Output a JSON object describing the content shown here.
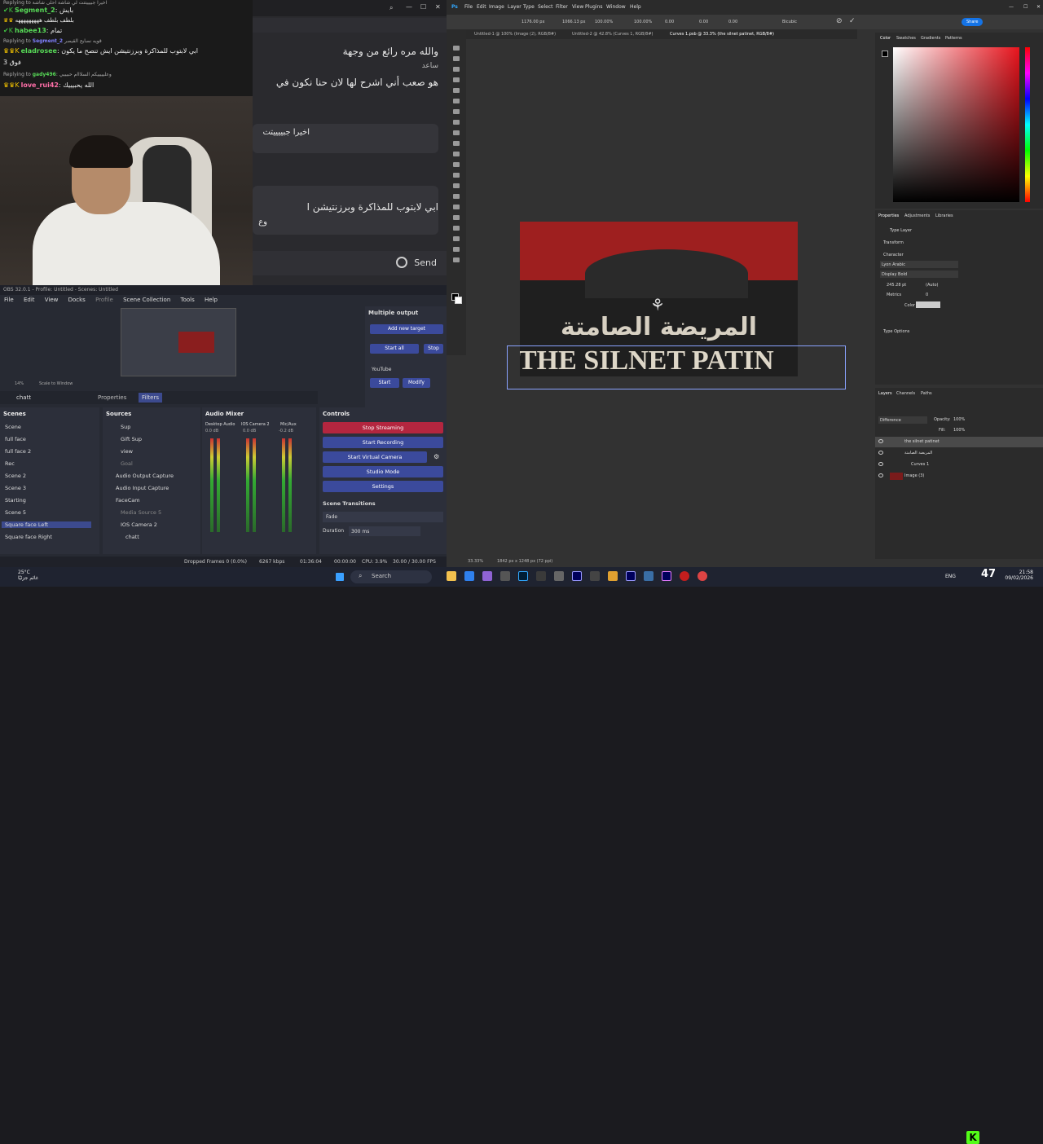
{
  "chat": {
    "lines": [
      {
        "text": "Replying to",
        "user": "",
        "msg": "اخيرا جبيييتتت لي شاشة احلى شاشة",
        "small": true
      },
      {
        "text": "",
        "user": "Segment_2",
        "msg": "بايش",
        "small": false
      },
      {
        "text": "",
        "user": "",
        "msg": "بلطف بلطف هههههههههه",
        "small": false
      },
      {
        "text": "",
        "user": "habee13",
        "msg": "تمام",
        "small": false
      },
      {
        "text": "Replying to",
        "user": "Segment_2",
        "msg": "قويه نصايح القيصر",
        "small": true
      },
      {
        "text": "",
        "user": "eladrosee",
        "msg": "ابي لابتوب للمذاكرة وبرزنتيشن ايش تنصح ما يكون",
        "small": false
      },
      {
        "text": "",
        "user": "",
        "msg": "فوق 3",
        "small": false
      },
      {
        "text": "Replying to",
        "user": "gady496",
        "msg": "وعليييييكم السلااام حبيبيي",
        "small": true
      },
      {
        "text": "",
        "user": "love_rui42",
        "msg": "الله يحبيييك",
        "small": false
      }
    ]
  },
  "gpt": {
    "msg1": "والله مره رائع من وجهة",
    "msg1b": "ساعد",
    "msg2": "هو صعب أني اشرح لها لان حنا نكون في",
    "msg3": "اخيرا جبييييتت",
    "msg4": "ابي لابتوب للمذاكرة وبرزنتيشن ا",
    "msg4b": "وع",
    "send_label": "Send"
  },
  "obs": {
    "title": "OBS 32.0.1 - Profile: Untitled - Scenes: Untitled",
    "menu": [
      "File",
      "Edit",
      "View",
      "Docks",
      "Profile",
      "Scene Collection",
      "Tools",
      "Help"
    ],
    "zoom": "14%",
    "scale_label": "Scale to Window",
    "source_label": "chatt",
    "properties_tab": "Properties",
    "filters_tab": "Filters",
    "multi_output": {
      "title": "Multiple output",
      "add_target": "Add new target",
      "start_all": "Start all",
      "stop_all": "Stop",
      "youtube": "YouTube",
      "start": "Start",
      "modify": "Modify"
    },
    "scenes_title": "Scenes",
    "scenes": [
      "Scene",
      "full face",
      "full face 2",
      "Rec",
      "Scene 2",
      "Scene 3",
      "Starting",
      "Scene 5",
      "Square face Left",
      "Square face Right"
    ],
    "selected_scene": "Square face Left",
    "sources_title": "Sources",
    "sources": [
      "Sup",
      "Gift Sup",
      "view",
      "Goal",
      "Audio Output Capture",
      "Audio Input Capture",
      "FaceCam",
      "Media Source 5",
      "IOS Camera 2",
      "chatt"
    ],
    "mixer_title": "Audio Mixer",
    "mixer_channels": [
      {
        "name": "Desktop Audio",
        "db": "0.0 dB"
      },
      {
        "name": "IOS Camera 2",
        "db": "0.0 dB"
      },
      {
        "name": "Mic/Aux",
        "db": "-0.2 dB"
      }
    ],
    "controls_title": "Controls",
    "controls": {
      "stop_streaming": "Stop Streaming",
      "start_recording": "Start Recording",
      "start_virtual_camera": "Start Virtual Camera",
      "studio_mode": "Studio Mode",
      "settings": "Settings"
    },
    "transitions_title": "Scene Transitions",
    "transition": "Fade",
    "duration_label": "Duration",
    "duration": "300 ms",
    "status": {
      "dropped": "Dropped Frames 0 (0.0%)",
      "kbps": "6267 kbps",
      "live_time": "01:36:04",
      "rec_time": "00:00:00",
      "cpu": "CPU: 3.9%",
      "fps": "30.00 / 30.00 FPS"
    }
  },
  "ps": {
    "menu": [
      "File",
      "Edit",
      "Image",
      "Layer",
      "Type",
      "Select",
      "Filter",
      "View",
      "Plugins",
      "Window",
      "Help"
    ],
    "doc_tabs": [
      "Untitled-1 @ 100% (Image (2), RGB/8#)",
      "Untitled-2 @ 42.8% (Curves 1, RGB/8#)",
      "Curves 1.psb @ 33.3% (the silnet patinet, RGB/8#)"
    ],
    "options": {
      "x": "1176.00 px",
      "y": "1066.13 px",
      "w": "100.00%",
      "h": "100.00%",
      "angle": "0.00",
      "h_skew": "0.00",
      "v_skew": "0.00",
      "interpolation": "Bicubic"
    },
    "share_label": "Share",
    "canvas": {
      "arabic_title": "المريضة الصامتة",
      "english_title": "THE SILNET PATIN"
    },
    "zoom": "33.33%",
    "doc_size": "1842 px x 1248 px (72 ppi)",
    "color_tabs": [
      "Color",
      "Swatches",
      "Gradients",
      "Patterns"
    ],
    "properties_tabs": [
      "Properties",
      "Adjustments",
      "Libraries"
    ],
    "type_layer": "Type Layer",
    "transform_label": "Transform",
    "character_label": "Character",
    "font": "Lyon Arabic",
    "font_style": "Display Bold",
    "font_size": "245.28 pt",
    "leading": "(Auto)",
    "kerning": "Metrics",
    "tracking": "0",
    "color_label": "Color",
    "type_options": "Type Options",
    "layers_tabs": [
      "Layers",
      "Channels",
      "Paths"
    ],
    "blend_mode": "Difference",
    "opacity_label": "Opacity:",
    "opacity": "100%",
    "fill_label": "Fill:",
    "fill": "100%",
    "layers": [
      "the silnet patinet",
      "المريضة الصامتة",
      "Curves 1",
      "Image (3)"
    ],
    "selected_layer": "the silnet patinet"
  },
  "taskbar": {
    "weather_temp": "25°C",
    "weather_desc": "غائم جزئيًا",
    "search": "Search",
    "lang": "ENG",
    "time": "21:58",
    "date": "09/02/2026",
    "kick_viewers": "47"
  }
}
